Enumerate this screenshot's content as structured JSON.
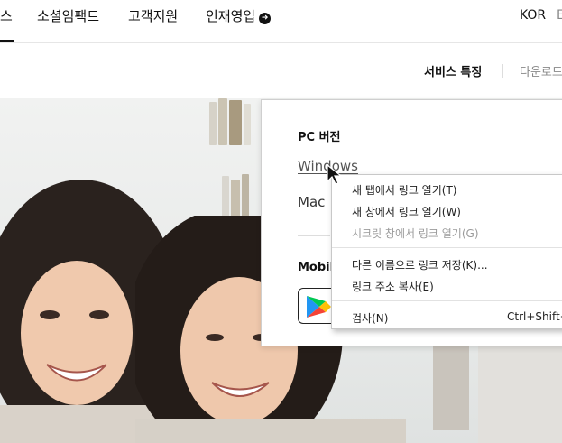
{
  "top_nav": {
    "partial_item": "스",
    "items": [
      "소셜임팩트",
      "고객지원",
      "인재영입"
    ],
    "language": "KOR",
    "language_extra": "E"
  },
  "sub_nav": {
    "service_features": "서비스 특징",
    "download_partial": "다운로드"
  },
  "download_panel": {
    "pc_title": "PC 버전",
    "windows_link": "Windows",
    "mac_link": "Mac",
    "mobile_title": "Mobil"
  },
  "context_menu": {
    "items": [
      {
        "label": "새 탭에서 링크 열기(T)",
        "enabled": true
      },
      {
        "label": "새 창에서 링크 열기(W)",
        "enabled": true
      },
      {
        "label": "시크릿 창에서 링크 열기(G)",
        "enabled": false
      },
      {
        "label": "다른 이름으로 링크 저장(K)...",
        "enabled": true
      },
      {
        "label": "링크 주소 복사(E)",
        "enabled": true
      },
      {
        "label": "검사(N)",
        "enabled": true
      }
    ],
    "inspect_shortcut": "Ctrl+Shift+"
  },
  "colors": {
    "text_primary": "#111111",
    "text_muted": "#888888",
    "disabled": "#9a9a9a",
    "play_green": "#00c853",
    "play_blue": "#2196f3",
    "play_yellow": "#ffc107",
    "play_red": "#f44336"
  }
}
